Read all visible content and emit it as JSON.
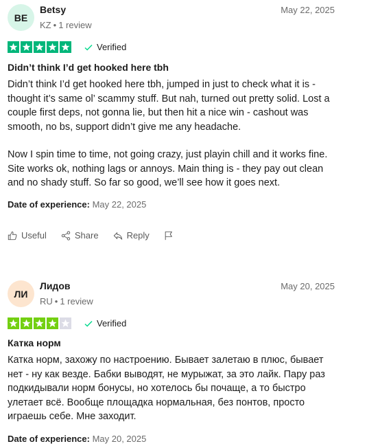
{
  "reviews": [
    {
      "initials": "BE",
      "name": "Betsy",
      "country": "KZ",
      "review_count": "1 review",
      "date": "May 22, 2025",
      "rating": 5,
      "verified_label": "Verified",
      "title": "Didn’t think I’d get hooked here tbh",
      "paragraph1": "Didn’t think I’d get hooked here tbh, jumped in just to check what it is - thought it’s same ol’ scammy stuff. But nah, turned out pretty solid. Lost a couple first deps, not gonna lie, but then hit a nice win - cashout was smooth, no bs, support didn’t give me any headache.",
      "paragraph2": "Now I spin time to time, not going crazy, just playin chill and it works fine. Site works ok, nothing lags or annoys. Main thing is - they pay out clean and no shady stuff. So far so good, we’ll see how it goes next.",
      "doe_label": "Date of experience:",
      "doe_value": "May 22, 2025"
    },
    {
      "initials": "ЛИ",
      "name": "Лидов",
      "country": "RU",
      "review_count": "1 review",
      "date": "May 20, 2025",
      "rating": 4,
      "verified_label": "Verified",
      "title": "Катка норм",
      "paragraph1": "Катка норм, захожу по настроению. Бывает залетаю в плюс, бывает нет - ну как везде. Бабки выводят, не мурыжат, за это лайк. Пару раз подкидывали норм бонусы, но хотелось бы почаще, а то быстро улетает всё. Вообще площадка нормальная, без понтов, просто играешь себе. Мне заходит.",
      "doe_label": "Date of experience:",
      "doe_value": "May 20, 2025"
    }
  ],
  "actions": {
    "useful": "Useful",
    "share": "Share",
    "reply": "Reply"
  },
  "colors": {
    "star_fill": "#00b67a",
    "star_4": "#73cf11",
    "star_empty": "#dcdce6",
    "verified_check": "#04da8d"
  }
}
